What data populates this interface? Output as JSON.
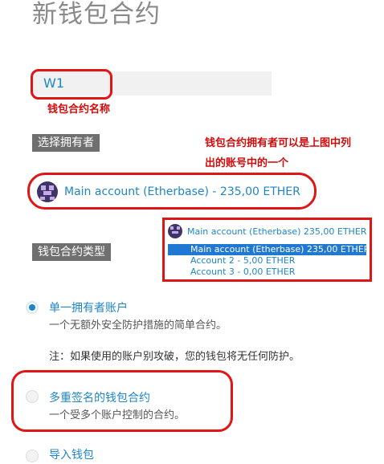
{
  "page_title": "新钱包合约",
  "name_field": {
    "value": "W1"
  },
  "annotations": {
    "name_note": "钱包合约名称",
    "owner_note_line1": "钱包合约拥有者可以是上图中列",
    "owner_note_line2": "出的账号中的一个"
  },
  "owner": {
    "section_label": "选择拥有者",
    "selected": "Main account (Etherbase) - 235,00 ETHER"
  },
  "dropdown": {
    "header": "Main account (Etherbase)   235,00 ETHER",
    "items": [
      {
        "label": "Main account (Etherbase)   235,00 ETHER",
        "selected": true
      },
      {
        "label": "Account 2 - 5,00 ETHER",
        "selected": false
      },
      {
        "label": "Account 3 - 0,00 ETHER",
        "selected": false
      }
    ]
  },
  "type": {
    "section_label": "钱包合约类型",
    "options": [
      {
        "title": "单一拥有者账户",
        "desc": "一个无额外安全防护措施的简单合约。",
        "checked": true
      },
      {
        "title": "多重签名的钱包合约",
        "desc": "一个受多个账户控制的合约。",
        "checked": false
      },
      {
        "title": "导入钱包",
        "desc": "",
        "checked": false
      }
    ],
    "warning": "注：如果使用的账户别攻破，您的钱包将无任何防护。"
  },
  "colors": {
    "accent": "#1f86c8",
    "annotation_red": "#e01515",
    "label_bg": "#707070"
  }
}
